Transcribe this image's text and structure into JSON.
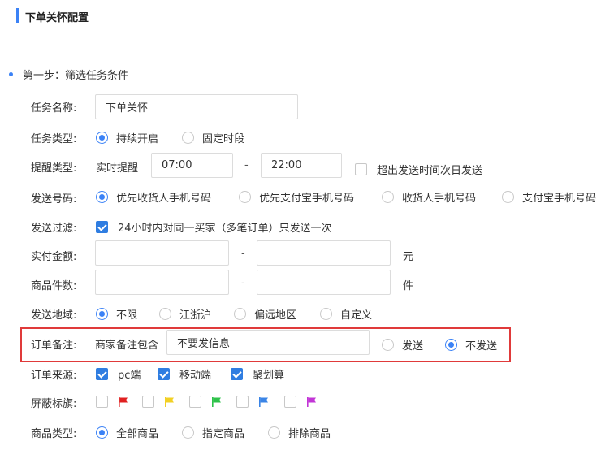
{
  "header": {
    "title": "下单关怀配置"
  },
  "step1": {
    "title": "第一步：筛选任务条件"
  },
  "task_name": {
    "label": "任务名称:",
    "value": "下单关怀"
  },
  "task_type": {
    "label": "任务类型:",
    "options": [
      "持续开启",
      "固定时段"
    ],
    "selected": 0
  },
  "remind_type": {
    "label": "提醒类型:",
    "mode_text": "实时提醒",
    "start_time": "07:00",
    "separator": "-",
    "end_time": "22:00",
    "next_day_label": "超出发送时间次日发送",
    "next_day_checked": false
  },
  "send_number": {
    "label": "发送号码:",
    "options": [
      "优先收货人手机号码",
      "优先支付宝手机号码",
      "收货人手机号码",
      "支付宝手机号码"
    ],
    "selected": 0
  },
  "send_filter": {
    "label": "发送过滤:",
    "option_label": "24小时内对同一买家（多笔订单）只发送一次",
    "checked": true
  },
  "paid_amount": {
    "label": "实付金额:",
    "min": "",
    "max": "",
    "separator": "-",
    "unit": "元"
  },
  "item_count": {
    "label": "商品件数:",
    "min": "",
    "max": "",
    "separator": "-",
    "unit": "件"
  },
  "send_region": {
    "label": "发送地域:",
    "options": [
      "不限",
      "江浙沪",
      "偏远地区",
      "自定义"
    ],
    "selected": 0
  },
  "order_note": {
    "label": "订单备注:",
    "contains_label": "商家备注包含",
    "value": "不要发信息",
    "options": [
      "发送",
      "不发送"
    ],
    "selected": 1
  },
  "order_source": {
    "label": "订单来源:",
    "options": [
      {
        "label": "pc端",
        "checked": true
      },
      {
        "label": "移动端",
        "checked": true
      },
      {
        "label": "聚划算",
        "checked": true
      }
    ]
  },
  "block_flags": {
    "label": "屏蔽标旗:",
    "flags": [
      {
        "icon": "red-flag-icon",
        "color": "#e02020",
        "checked": false
      },
      {
        "icon": "yellow-flag-icon",
        "color": "#f2d024",
        "checked": false
      },
      {
        "icon": "green-flag-icon",
        "color": "#2ec24a",
        "checked": false
      },
      {
        "icon": "blue-flag-icon",
        "color": "#3a84e6",
        "checked": false
      },
      {
        "icon": "purple-flag-icon",
        "color": "#c235d6",
        "checked": false
      }
    ]
  },
  "product_type": {
    "label": "商品类型:",
    "options": [
      "全部商品",
      "指定商品",
      "排除商品"
    ],
    "selected": 0
  },
  "colors": {
    "accent": "#3b82f6",
    "highlight_border": "#e03a3a"
  }
}
